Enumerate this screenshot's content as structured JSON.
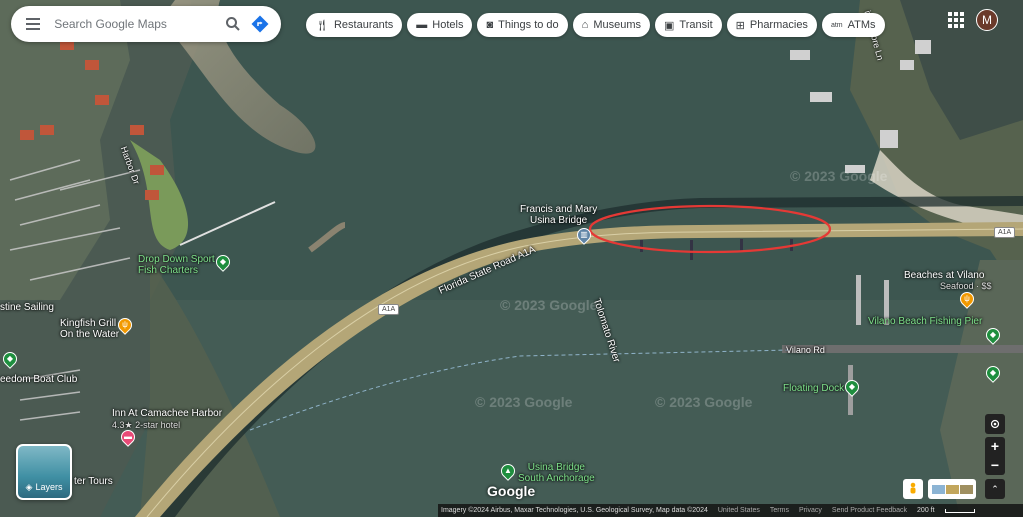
{
  "search": {
    "placeholder": "Search Google Maps"
  },
  "chips": [
    {
      "label": "Restaurants",
      "icon": "fork-knife-icon"
    },
    {
      "label": "Hotels",
      "icon": "bed-icon"
    },
    {
      "label": "Things to do",
      "icon": "camera-icon"
    },
    {
      "label": "Museums",
      "icon": "museum-icon"
    },
    {
      "label": "Transit",
      "icon": "train-icon"
    },
    {
      "label": "Pharmacies",
      "icon": "pharmacy-icon"
    },
    {
      "label": "ATMs",
      "icon": "atm-icon"
    }
  ],
  "account": {
    "initial": "M"
  },
  "layers": {
    "label": "Layers"
  },
  "places": {
    "bridge": "Francis and Mary\nUsina Bridge",
    "drop_down": "Drop Down Sport\nFish Charters",
    "kingfish": "Kingfish Grill\nOn the Water",
    "sailing": "stine Sailing",
    "freedom": "eedom Boat Club",
    "inn": "Inn At Camachee Harbor",
    "inn_sub": "4.3★ 2-star hotel",
    "tours": "ter Tours",
    "beaches": "Beaches at Vilano",
    "beaches_sub": "Seafood · $$",
    "vilano_beach": "Vilano Beach Fishing Pier",
    "vilano_rd": "Vilano Rd",
    "floating_dock": "Floating Dock",
    "usina_anchorage": "Usina Bridge\nSouth Anchorage"
  },
  "roads": {
    "a1a_name": "Florida State Road A1A",
    "a1a_shield": "A1A",
    "tolomato": "Tolomato River",
    "harbor_dr": "Harbor Dr",
    "riverside_ln": "iverShore Ln"
  },
  "watermark": "© 2023 Google",
  "logo": "Google",
  "attribution": {
    "imagery": "Imagery ©2024 Airbus, Maxar Technologies, U.S. Geological Survey, Map data ©2024",
    "country": "United States",
    "terms": "Terms",
    "privacy": "Privacy",
    "feedback": "Send Product Feedback",
    "scale": "200 ft"
  },
  "colors": {
    "water": "#3d5650",
    "annotation": "#e53935",
    "park_pin": "#1e8e3e",
    "food_pin": "#f29900",
    "hotel_pin": "#e84a77"
  }
}
